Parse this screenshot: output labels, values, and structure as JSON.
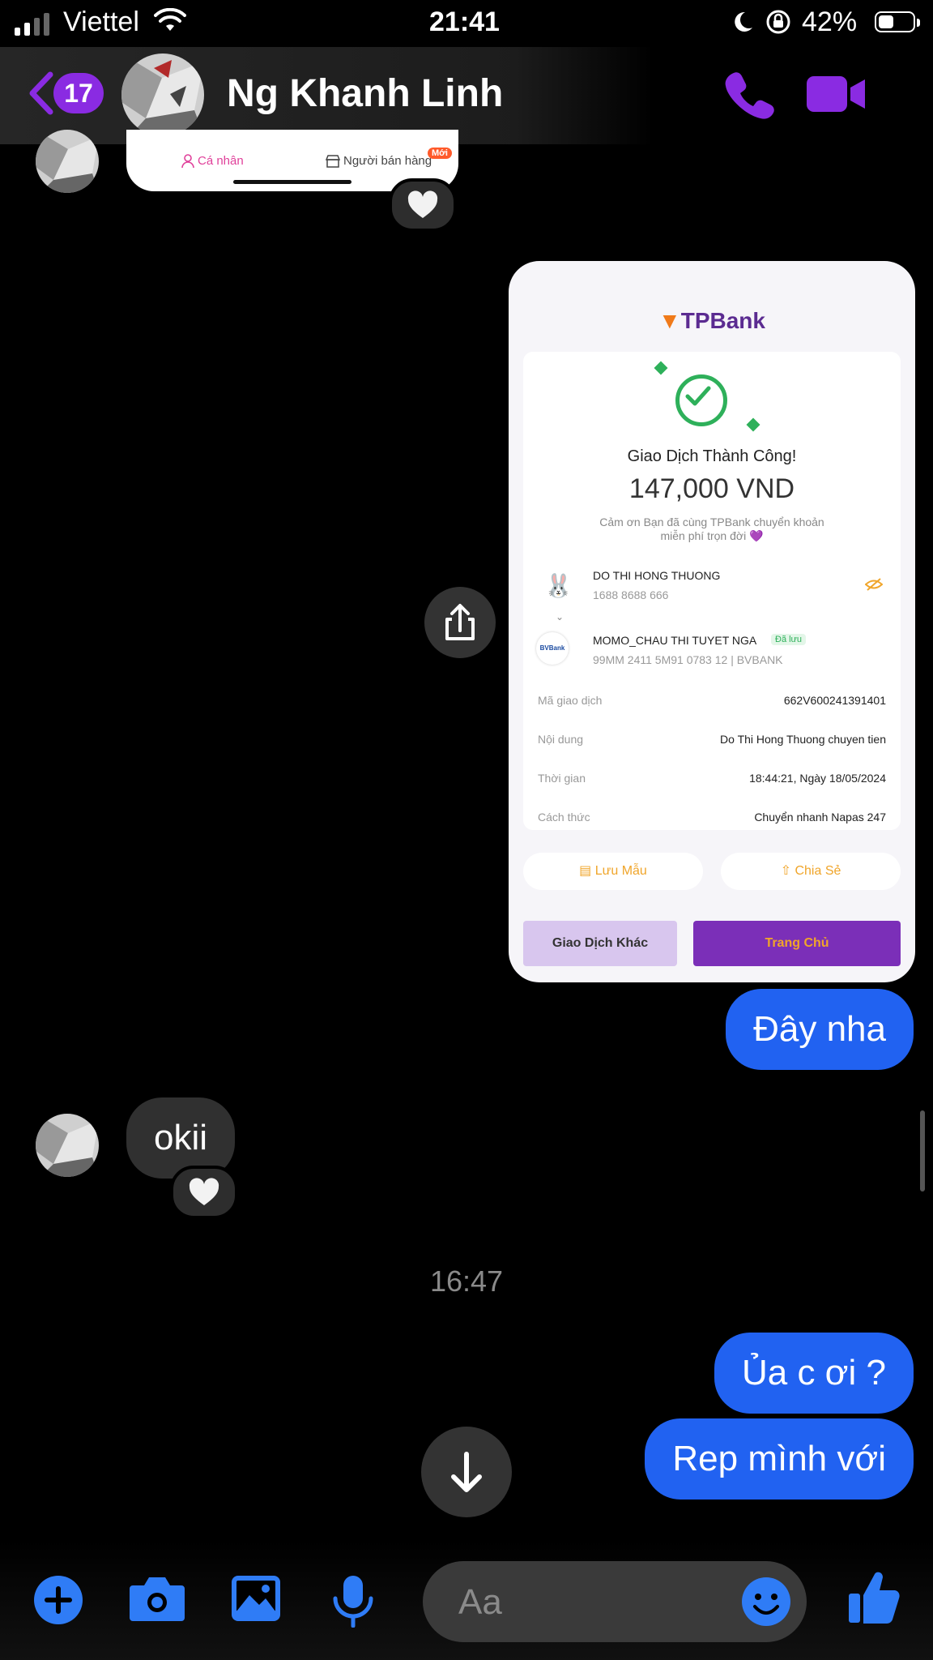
{
  "status_bar": {
    "carrier": "Viettel",
    "time": "21:41",
    "battery": "42%"
  },
  "header": {
    "back_badge": "17",
    "contact_name": "Ng Khanh Linh"
  },
  "colors": {
    "accent": "#8a2be2",
    "outgoing": "#2162f1",
    "incoming": "#303030",
    "composer_icon": "#2f7cf6"
  },
  "partial_screenshot": {
    "tab_personal": "Cá nhân",
    "tab_seller": "Người bán hàng",
    "badge_new": "Mới"
  },
  "bank_receipt": {
    "logo": "TPBank",
    "status": "Giao Dịch Thành Công!",
    "amount": "147,000 VND",
    "thanks_line1": "Cảm ơn Bạn đã cùng TPBank chuyển khoản",
    "thanks_line2": "miễn phí trọn đời 💜",
    "sender_name": "DO THI HONG THUONG",
    "sender_account": "1688 8688 666",
    "recipient_name": "MOMO_CHAU THI TUYET NGA",
    "recipient_saved": "Đã lưu",
    "recipient_account": "99MM 2411 5M91 0783 12 | BVBANK",
    "rows": [
      {
        "label": "Mã giao dịch",
        "value": "662V600241391401"
      },
      {
        "label": "Nội dung",
        "value": "Do Thi Hong Thuong chuyen tien"
      },
      {
        "label": "Thời gian",
        "value": "18:44:21, Ngày 18/05/2024"
      },
      {
        "label": "Cách thức",
        "value": "Chuyển nhanh Napas 247"
      }
    ],
    "save_template": "Lưu Mẫu",
    "share": "Chia Sẻ",
    "other_transaction": "Giao Dịch Khác",
    "home": "Trang Chủ"
  },
  "messages": {
    "msg_day_nha": "Đây nha",
    "msg_okii": "okii",
    "timestamp": "16:47",
    "msg_ua_c_oi": "Ủa c ơi ?",
    "msg_rep": "Rep mình với"
  },
  "composer": {
    "placeholder": "Aa"
  },
  "icons": [
    "back-chevron-icon",
    "phone-icon",
    "video-icon",
    "heart-icon",
    "share-icon",
    "arrow-down-icon",
    "plus-icon",
    "camera-icon",
    "gallery-icon",
    "microphone-icon",
    "emoji-icon",
    "thumbs-up-icon"
  ]
}
